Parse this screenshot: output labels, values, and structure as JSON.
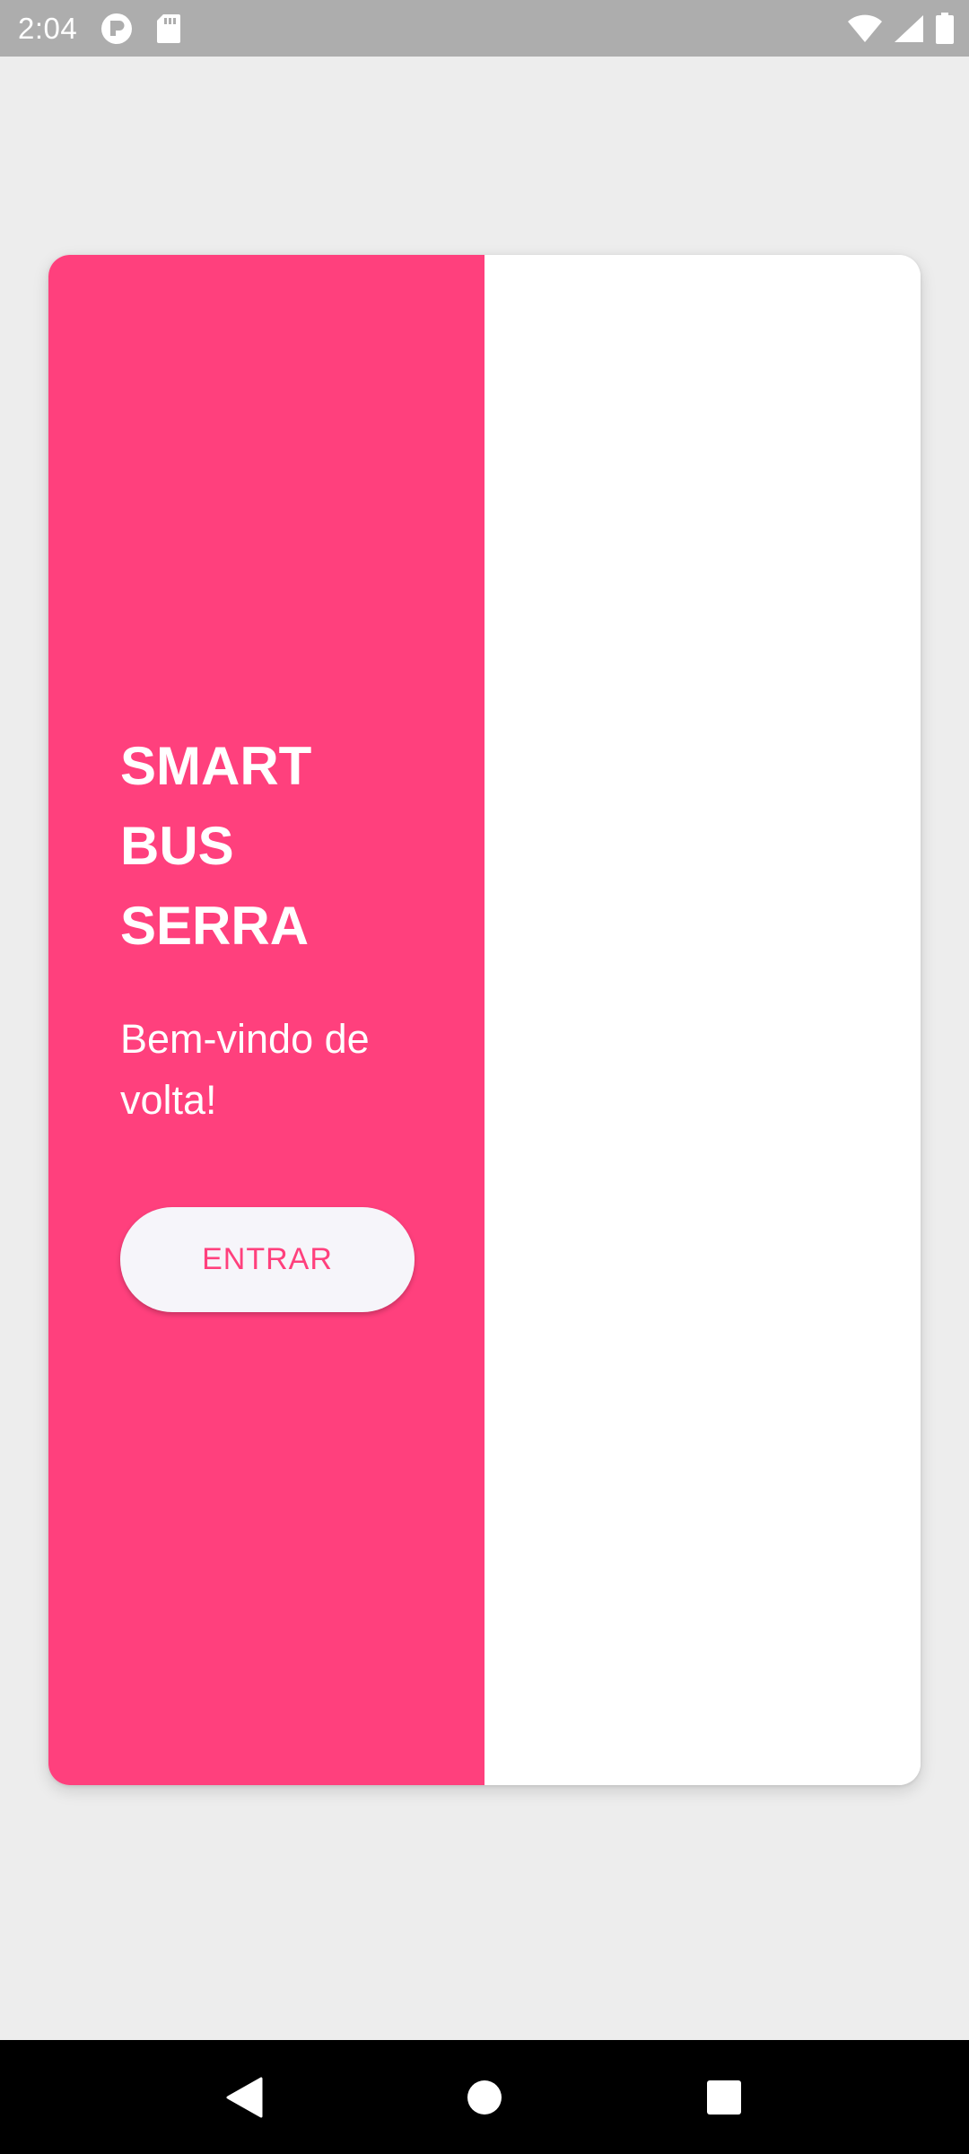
{
  "status_bar": {
    "time": "2:04",
    "left_icons": [
      "p-circle-icon",
      "sd-card-icon"
    ],
    "right_icons": [
      "wifi-icon",
      "cell-signal-icon",
      "battery-icon"
    ]
  },
  "app": {
    "title_lines": [
      "SMART",
      "BUS",
      "SERRA"
    ],
    "welcome_text": "Bem-vindo de volta!",
    "enter_button_label": "ENTRAR",
    "colors": {
      "accent": "#ff407d",
      "button_bg": "#f6f5fa",
      "background": "#ededed",
      "card_right": "#ffffff"
    }
  },
  "nav_bar": {
    "buttons": [
      "back-icon",
      "home-icon",
      "recents-icon"
    ]
  }
}
